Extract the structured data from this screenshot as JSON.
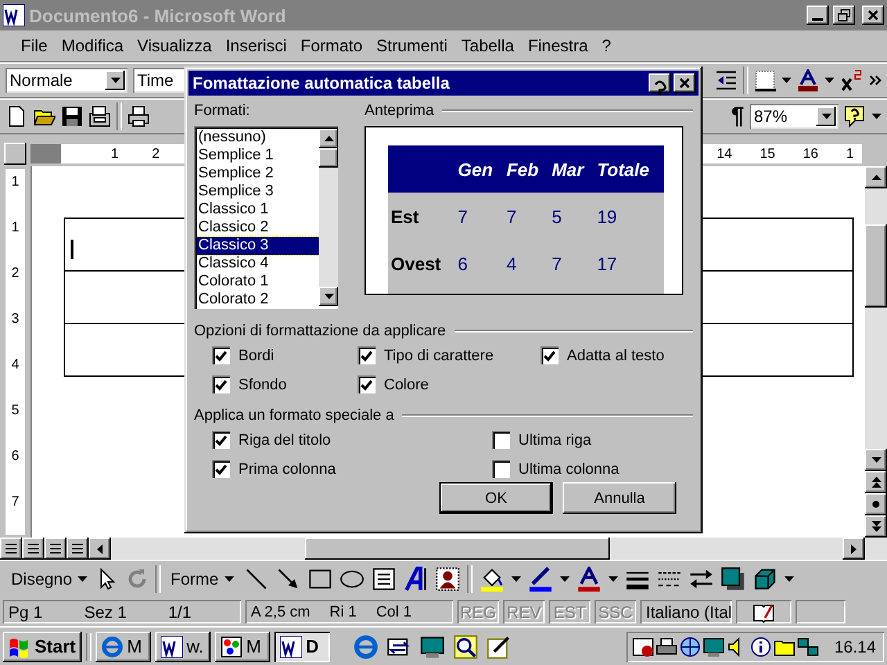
{
  "window": {
    "title": "Documento6 - Microsoft Word"
  },
  "menu": [
    {
      "label": "File"
    },
    {
      "label": "Modifica"
    },
    {
      "label": "Visualizza"
    },
    {
      "label": "Inserisci"
    },
    {
      "label": "Formato"
    },
    {
      "label": "Strumenti"
    },
    {
      "label": "Tabella"
    },
    {
      "label": "Finestra"
    },
    {
      "label": "?"
    }
  ],
  "formatting_toolbar": {
    "style": "Normale",
    "font": "Time"
  },
  "standard_toolbar": {
    "pilcrow": "¶",
    "zoom": "87%"
  },
  "horizontal_ruler": {
    "left_numbers": [
      "1",
      "2"
    ],
    "right_numbers": [
      "14",
      "15",
      "16",
      "1"
    ]
  },
  "vertical_ruler": {
    "numbers": [
      "1",
      "1",
      "2",
      "3",
      "4",
      "5",
      "6",
      "7"
    ]
  },
  "dialog": {
    "title": "Fomattazione automatica tabella",
    "formats_label": "Formati:",
    "formats": [
      {
        "label": "(nessuno)",
        "selected": false
      },
      {
        "label": "Semplice 1",
        "selected": false
      },
      {
        "label": "Semplice 2",
        "selected": false
      },
      {
        "label": "Semplice 3",
        "selected": false
      },
      {
        "label": "Classico 1",
        "selected": false
      },
      {
        "label": "Classico 2",
        "selected": false
      },
      {
        "label": "Classico 3",
        "selected": true
      },
      {
        "label": "Classico 4",
        "selected": false
      },
      {
        "label": "Colorato 1",
        "selected": false
      },
      {
        "label": "Colorato 2",
        "selected": false
      }
    ],
    "preview_label": "Anteprima",
    "preview": {
      "columns": [
        "",
        "Gen",
        "Feb",
        "Mar",
        "Totale"
      ],
      "rows": [
        [
          "Est",
          "7",
          "7",
          "5",
          "19"
        ],
        [
          "Ovest",
          "6",
          "4",
          "7",
          "17"
        ]
      ]
    },
    "options_label": "Opzioni di formattazione da applicare",
    "options": [
      {
        "label": "Bordi",
        "checked": true
      },
      {
        "label": "Tipo di carattere",
        "checked": true
      },
      {
        "label": "Adatta al testo",
        "checked": true
      },
      {
        "label": "Sfondo",
        "checked": true
      },
      {
        "label": "Colore",
        "checked": true
      }
    ],
    "special_label": "Applica un formato speciale a",
    "special": [
      {
        "label": "Riga del titolo",
        "checked": true
      },
      {
        "label": "Ultima riga",
        "checked": false
      },
      {
        "label": "Prima colonna",
        "checked": true
      },
      {
        "label": "Ultima colonna",
        "checked": false
      }
    ],
    "buttons": [
      {
        "label": "OK",
        "default": true
      },
      {
        "label": "Annulla",
        "default": false
      }
    ]
  },
  "drawing_toolbar": {
    "draw_menu": "Disegno",
    "shapes_menu": "Forme"
  },
  "status_bar": {
    "page_group": [
      "Pg 1",
      "Sez 1",
      "1/1"
    ],
    "position_group": [
      "A 2,5 cm",
      "Ri 1",
      "Col 1"
    ],
    "modes": [
      {
        "label": "REG",
        "disabled": true
      },
      {
        "label": "REV",
        "disabled": true
      },
      {
        "label": "EST",
        "disabled": true
      },
      {
        "label": "SSC",
        "disabled": true
      }
    ],
    "language": "Italiano (Ital"
  },
  "taskbar": {
    "start": "Start",
    "tasks": [
      {
        "label": "M",
        "selected": false
      },
      {
        "label": "w.",
        "selected": false
      },
      {
        "label": "M",
        "selected": false
      },
      {
        "label": "D",
        "selected": true
      }
    ],
    "clock": "16.14"
  }
}
